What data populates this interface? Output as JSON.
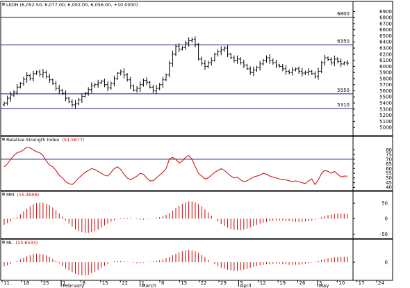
{
  "colors": {
    "price": "#000000",
    "rsi": "#cc0000",
    "osc": "#cc0000",
    "level": "#1a1a8c",
    "grid": "#9a9a9a"
  },
  "panes": {
    "price": {
      "title": "LKOH (6,052.50, 6,077.00, 6,002.00, 6,056.00, +10.0000)"
    },
    "rsi": {
      "title": "Relative Strength Index",
      "value": "(51.5877)"
    },
    "mm": {
      "title": "MM",
      "value": "(15.4906)"
    },
    "ml": {
      "title": "ML",
      "value": "(13.8533)"
    }
  },
  "chart_data": [
    {
      "type": "ohlc",
      "title": "LKOH (6,052.50, 6,077.00, 6,002.00, 6,056.00, +10.0000)",
      "ylim": [
        4900,
        6950
      ],
      "yticks": [
        6900,
        6800,
        6700,
        6600,
        6500,
        6400,
        6300,
        6200,
        6100,
        6000,
        5900,
        5800,
        5700,
        5600,
        5500,
        5400,
        5300,
        5200,
        5100,
        5000
      ],
      "levels": [
        {
          "value": 6800,
          "label": "6800"
        },
        {
          "value": 6350,
          "label": "6350"
        },
        {
          "value": 5550,
          "label": "5550"
        },
        {
          "value": 5310,
          "label": "5310"
        }
      ],
      "x_labels": [
        "11",
        "18",
        "25",
        "1",
        "8",
        "15",
        "22",
        "1",
        "8",
        "15",
        "22",
        "29",
        "5",
        "12",
        "19",
        "26",
        "3",
        "10",
        "17",
        "24"
      ],
      "month_labels": [
        "February",
        "March",
        "April",
        "May"
      ],
      "closes": [
        5400,
        5480,
        5530,
        5580,
        5660,
        5720,
        5790,
        5850,
        5800,
        5880,
        5910,
        5870,
        5900,
        5830,
        5780,
        5720,
        5640,
        5600,
        5560,
        5480,
        5420,
        5370,
        5390,
        5450,
        5510,
        5560,
        5620,
        5680,
        5700,
        5730,
        5760,
        5700,
        5650,
        5720,
        5800,
        5890,
        5910,
        5860,
        5780,
        5680,
        5610,
        5640,
        5700,
        5770,
        5740,
        5660,
        5600,
        5640,
        5700,
        5780,
        5860,
        6050,
        6200,
        6330,
        6280,
        6310,
        6380,
        6420,
        6440,
        6360,
        6120,
        6050,
        6000,
        6060,
        6100,
        6200,
        6240,
        6270,
        6300,
        6200,
        6140,
        6100,
        6120,
        6060,
        6020,
        5960,
        5900,
        5940,
        5980,
        6040,
        6100,
        6140,
        6100,
        6060,
        6020,
        6000,
        5960,
        5920,
        5900,
        5940,
        5960,
        5920,
        5890,
        5900,
        5920,
        5880,
        5840,
        5920,
        6060,
        6140,
        6110,
        6060,
        6120,
        6080,
        6040,
        6060,
        6050
      ]
    },
    {
      "type": "line",
      "title": "Relative Strength Index",
      "value_label": "(51.5877)",
      "ylim": [
        38,
        87
      ],
      "yticks": [
        80,
        75,
        70,
        65,
        60,
        55,
        50,
        45,
        40
      ],
      "reference_line": 70,
      "values": [
        62,
        65,
        70,
        74,
        77,
        78,
        80,
        83,
        82,
        80,
        78,
        77,
        74,
        68,
        64,
        62,
        58,
        53,
        50,
        46,
        44,
        43,
        46,
        50,
        53,
        56,
        58,
        60,
        59,
        57,
        55,
        53,
        52,
        56,
        60,
        62,
        59,
        54,
        50,
        48,
        50,
        52,
        55,
        54,
        50,
        47,
        47,
        50,
        53,
        56,
        60,
        70,
        72,
        70,
        66,
        68,
        72,
        74,
        70,
        62,
        55,
        52,
        49,
        50,
        53,
        56,
        58,
        60,
        58,
        55,
        52,
        50,
        51,
        48,
        46,
        47,
        49,
        51,
        52,
        53,
        55,
        54,
        52,
        51,
        50,
        49,
        48,
        48,
        47,
        46,
        47,
        46,
        45,
        44,
        47,
        49,
        43,
        48,
        55,
        58,
        57,
        55,
        57,
        54,
        51,
        52,
        52
      ]
    },
    {
      "type": "bar",
      "title": "MM",
      "value_label": "(15.4906)",
      "ylim": [
        -62,
        68
      ],
      "yticks": [
        50,
        0,
        -50
      ],
      "values": [
        -20,
        -15,
        -8,
        -2,
        5,
        14,
        24,
        32,
        40,
        46,
        50,
        52,
        51,
        48,
        43,
        36,
        27,
        17,
        6,
        -6,
        -16,
        -26,
        -34,
        -40,
        -44,
        -46,
        -46,
        -44,
        -40,
        -35,
        -29,
        -22,
        -16,
        -10,
        -5,
        -1,
        2,
        3,
        3,
        2,
        0,
        -2,
        -3,
        -3,
        -2,
        -1,
        1,
        3,
        5,
        8,
        12,
        18,
        26,
        34,
        42,
        48,
        53,
        56,
        56,
        53,
        47,
        39,
        30,
        20,
        10,
        0,
        -9,
        -17,
        -24,
        -29,
        -33,
        -36,
        -37,
        -37,
        -35,
        -32,
        -28,
        -24,
        -20,
        -16,
        -13,
        -10,
        -8,
        -7,
        -6,
        -6,
        -6,
        -7,
        -8,
        -9,
        -10,
        -10,
        -10,
        -9,
        -8,
        -6,
        -3,
        1,
        5,
        9,
        12,
        14,
        15,
        16,
        16,
        16,
        15
      ]
    },
    {
      "type": "bar",
      "title": "ML",
      "value_label": "(13.8533)",
      "ylim": [
        -32,
        32
      ],
      "yticks": [
        0
      ],
      "values": [
        -8,
        -6,
        -3,
        0,
        3,
        6,
        9,
        12,
        14,
        16,
        17,
        17,
        16,
        14,
        11,
        7,
        3,
        -2,
        -7,
        -12,
        -16,
        -20,
        -23,
        -25,
        -26,
        -26,
        -25,
        -22,
        -19,
        -15,
        -11,
        -7,
        -3,
        0,
        2,
        3,
        3,
        2,
        1,
        0,
        -1,
        -2,
        -2,
        -1,
        0,
        1,
        2,
        3,
        4,
        6,
        8,
        11,
        14,
        17,
        20,
        22,
        24,
        25,
        24,
        22,
        19,
        15,
        10,
        5,
        0,
        -4,
        -8,
        -11,
        -13,
        -15,
        -16,
        -17,
        -17,
        -16,
        -15,
        -13,
        -11,
        -9,
        -7,
        -6,
        -5,
        -4,
        -4,
        -3,
        -3,
        -3,
        -4,
        -4,
        -5,
        -5,
        -5,
        -5,
        -4,
        -3,
        -2,
        -1,
        1,
        3,
        5,
        7,
        8,
        9,
        10,
        11,
        11,
        11,
        11
      ]
    }
  ]
}
